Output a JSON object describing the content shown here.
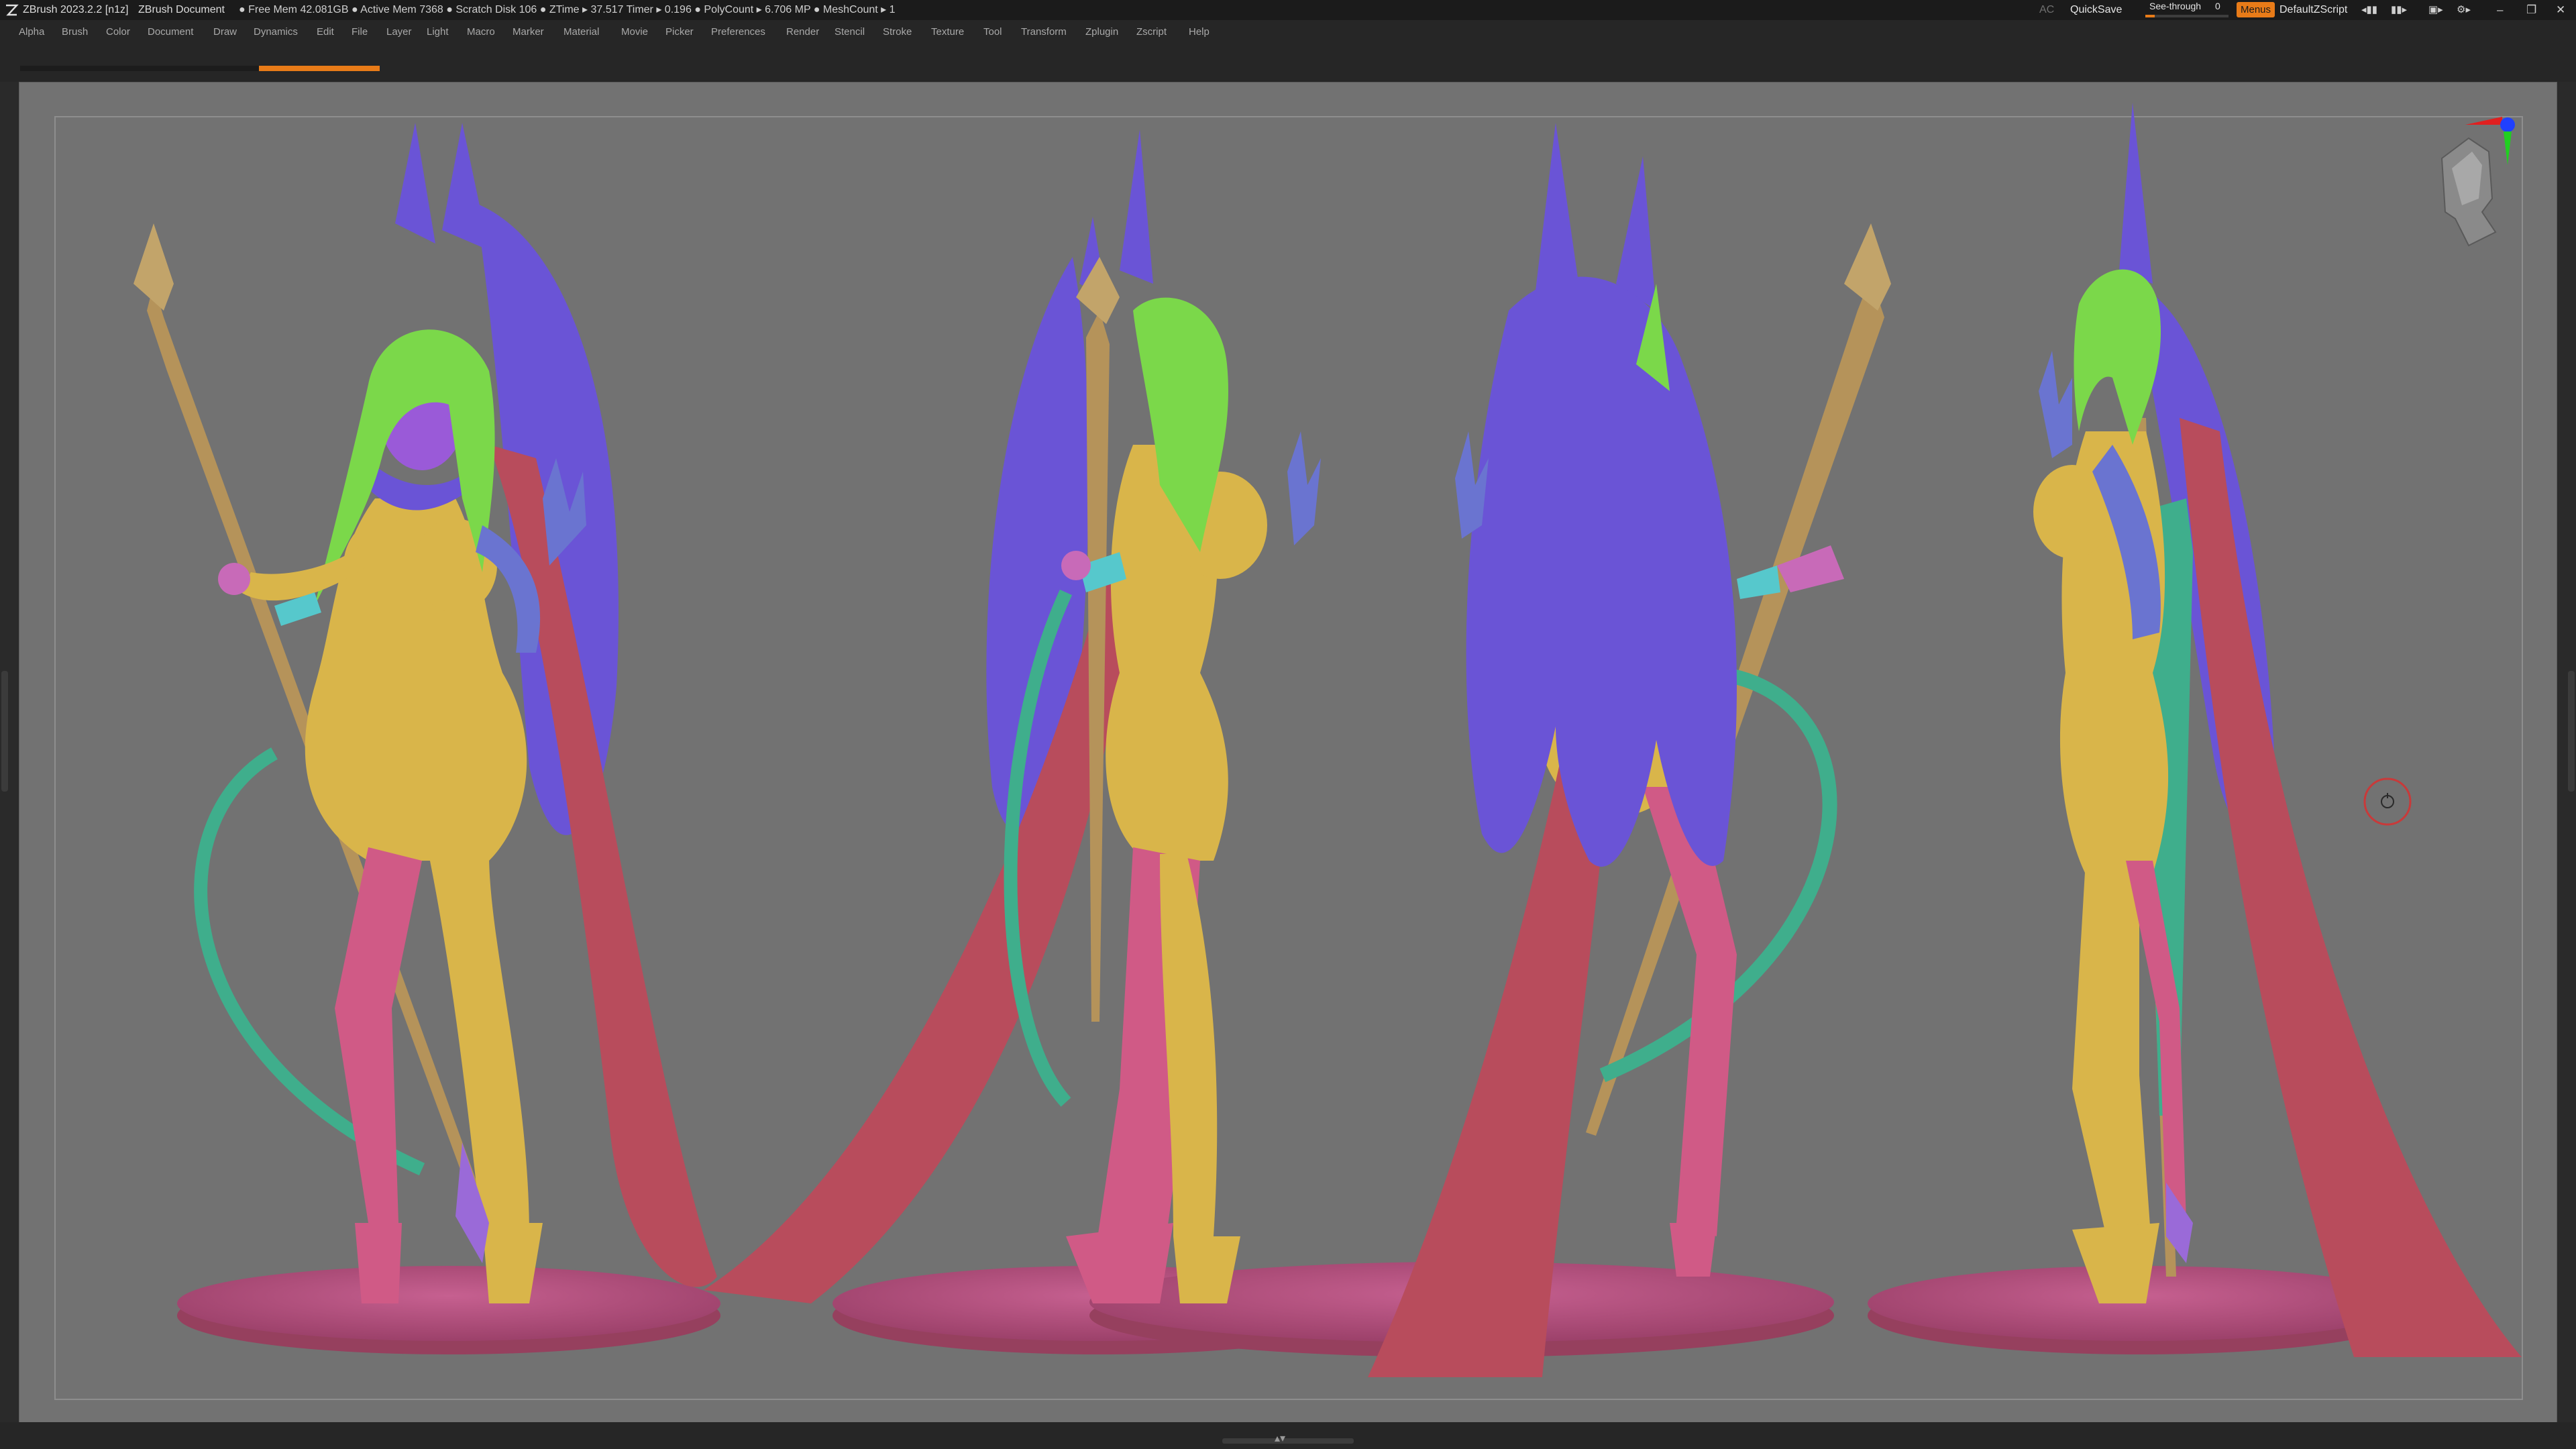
{
  "titlebar": {
    "app_title": "ZBrush 2023.2.2 [n1z]",
    "document_title": "ZBrush Document",
    "stats": "● Free Mem 42.081GB ● Active Mem 7368 ● Scratch Disk 106 ●   ZTime ▸ 37.517 Timer ▸ 0.196 ● PolyCount ▸ 6.706 MP   ● MeshCount ▸ 1",
    "ac_label": "AC",
    "quicksave_label": "QuickSave",
    "seethrough_label": "See-through",
    "seethrough_value": "0",
    "menus_label": "Menus",
    "zscript_label": "DefaultZScript"
  },
  "menubar": {
    "items": [
      "Alpha",
      "Brush",
      "Color",
      "Document",
      "Draw",
      "Dynamics",
      "Edit",
      "File",
      "Layer",
      "Light",
      "Macro",
      "Marker",
      "Material",
      "Movie",
      "Picker",
      "Preferences",
      "Render",
      "Stencil",
      "Stroke",
      "Texture",
      "Tool",
      "Transform",
      "Zplugin",
      "Zscript",
      "Help"
    ]
  },
  "viewport": {
    "subject": "four-view turnaround of a polypainted character figure on round bases",
    "colors": {
      "background": "#727272",
      "skin": "#d9b54a",
      "hair": "#6a54d6",
      "bangs": "#7bd84a",
      "cape": "#b84c5c",
      "stockings": "#d05a86",
      "base": "#b8507a",
      "tail": "#3fae8c",
      "accent": "#e87b18"
    }
  },
  "icons": {
    "logo": "zbrush-logo-icon",
    "nav_head": "navigation-head-icon",
    "rotate_cursor": "rotate-cursor-icon"
  }
}
